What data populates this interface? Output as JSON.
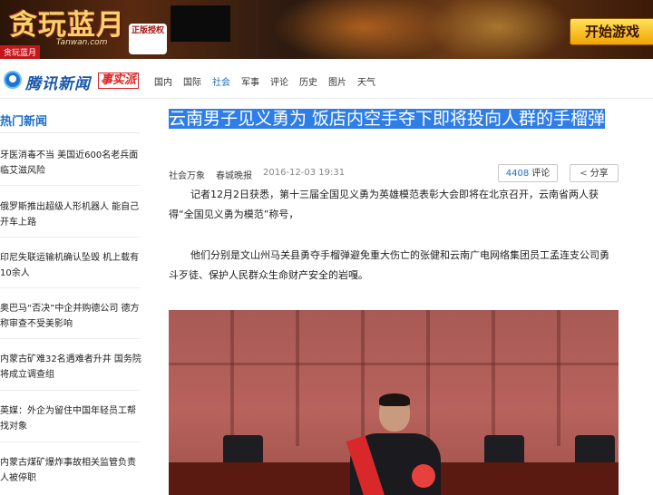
{
  "banner": {
    "logo_text": "贪玩蓝月",
    "site_text": "Tanwan.com",
    "tag_text": "贪玩蓝月",
    "seal_text": "正版授权",
    "cta_label": "开始游戏"
  },
  "header": {
    "brand": "腾讯新闻",
    "subbrand": "事实派",
    "nav": [
      "国内",
      "国际",
      "社会",
      "军事",
      "评论",
      "历史",
      "图片",
      "天气"
    ],
    "active_nav": "社会"
  },
  "sidebar": {
    "title": "热门新闻",
    "items": [
      "牙医消毒不当 美国近600名老兵面临艾滋风险",
      "俄罗斯推出超级人形机器人 能自己开车上路",
      "印尼失联运输机确认坠毁 机上载有10余人",
      "奥巴马“否决”中企并购德公司 德方称审查不受美影响",
      "内蒙古矿难32名遇难者升井 国务院将成立调查组",
      "英媒：外企为留住中国年轻员工帮找对象",
      "内蒙古煤矿爆炸事故相关监管负责人被停职"
    ]
  },
  "article": {
    "title": "云南男子见义勇为 饭店内空手夺下即将投向人群的手榴弹",
    "category": "社会万象",
    "source": "春城晚报",
    "date": "2016-12-03 19:31",
    "comment_count": "4408",
    "comment_label": "评论",
    "share_label": "分享",
    "paragraphs": [
      "记者12月2日获悉，第十三届全国见义勇为英雄模范表彰大会即将在北京召开，云南省两人获得“全国见义勇为模范”称号，",
      "他们分别是文山州马关县勇夺手榴弹避免重大伤亡的张健和云南广电网络集团员工孟连支公司勇斗歹徒、保护人民群众生命财产安全的岩嘎。"
    ]
  },
  "colors": {
    "accent": "#1e6dc5",
    "selection": "#2f7ee6",
    "cta": "#f2a400"
  }
}
